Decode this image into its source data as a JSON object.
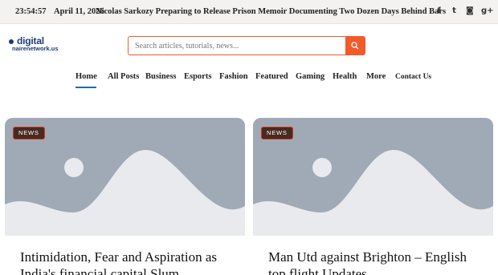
{
  "topbar": {
    "time": "23:54:57",
    "date": "April 11, 2026",
    "headline": "Nicolas Sarkozy Preparing to Release Prison Memoir Documenting Two Dozen Days Behind Bars",
    "socials": [
      {
        "icon": "facebook-icon",
        "glyph": "f"
      },
      {
        "icon": "twitter-icon",
        "glyph": "t"
      },
      {
        "icon": "instagram-icon",
        "glyph": "◙"
      },
      {
        "icon": "google-plus-icon",
        "glyph": "g+"
      }
    ]
  },
  "header": {
    "logo_line1": "digital",
    "logo_line2": "nairenetwork.us",
    "search_placeholder": "Search articles, tutorials, news..."
  },
  "nav": {
    "items": [
      "Home",
      "All Posts",
      "Business",
      "Esports",
      "Fashion",
      "Featured",
      "Gaming",
      "Health",
      "More",
      "Contact Us"
    ],
    "active": "Home"
  },
  "colors": {
    "accent": "#f25a2a",
    "nav_underline": "#1e6fa8",
    "badge_bg": "#4a2a20",
    "placeholder_bg": "#a0aab6",
    "placeholder_fg": "#e8eaed"
  },
  "cards": [
    {
      "badge": "NEWS",
      "title": "Intimidation, Fear and Aspiration as India's financial capital Slum"
    },
    {
      "badge": "NEWS",
      "title": "Man Utd against Brighton – English top flight Updates"
    }
  ]
}
